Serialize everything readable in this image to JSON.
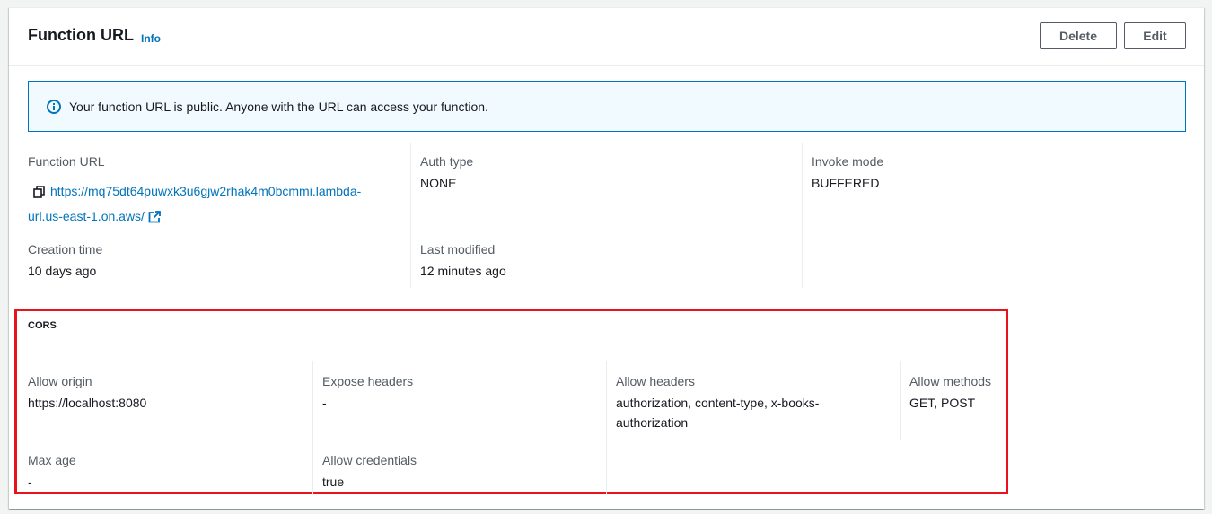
{
  "header": {
    "title": "Function URL",
    "info_label": "Info",
    "delete_label": "Delete",
    "edit_label": "Edit"
  },
  "alert": {
    "icon": "info-circle-icon",
    "message": "Your function URL is public. Anyone with the URL can access your function."
  },
  "details": {
    "function_url": {
      "label": "Function URL",
      "value_line1": "https://mq75dt64puwxk3u6gjw2rhak4m0bcmmi.lambda-",
      "value_line2": "url.us-east-1.on.aws/"
    },
    "auth_type": {
      "label": "Auth type",
      "value": "NONE"
    },
    "invoke_mode": {
      "label": "Invoke mode",
      "value": "BUFFERED"
    },
    "creation_time": {
      "label": "Creation time",
      "value": "10 days ago"
    },
    "last_modified": {
      "label": "Last modified",
      "value": "12 minutes ago"
    }
  },
  "cors": {
    "title": "CORS",
    "allow_origin": {
      "label": "Allow origin",
      "value": "https://localhost:8080"
    },
    "expose_headers": {
      "label": "Expose headers",
      "value": "-"
    },
    "allow_headers": {
      "label": "Allow headers",
      "value_line1": "authorization, content-type, x-books-",
      "value_line2": "authorization"
    },
    "allow_methods": {
      "label": "Allow methods",
      "value": "GET, POST"
    },
    "max_age": {
      "label": "Max age",
      "value": "-"
    },
    "allow_credentials": {
      "label": "Allow credentials",
      "value": "true"
    }
  },
  "colors": {
    "accent": "#0073bb",
    "highlight_border": "#e8131c",
    "alert_bg": "#f1faff"
  }
}
